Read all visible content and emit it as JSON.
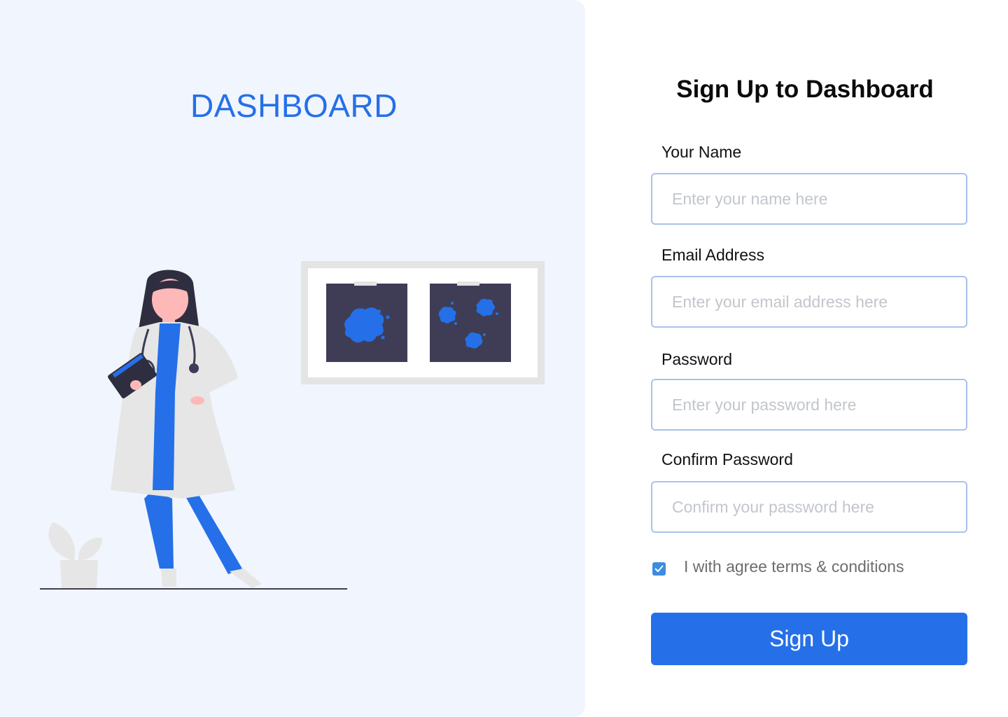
{
  "brand": {
    "title": "DASHBOARD"
  },
  "form": {
    "title": "Sign Up to Dashboard",
    "fields": [
      {
        "label": "Your Name",
        "placeholder": "Enter your name here",
        "value": ""
      },
      {
        "label": "Email Address",
        "placeholder": "Enter your email address here",
        "value": ""
      },
      {
        "label": "Password",
        "placeholder": "Enter your password here",
        "value": ""
      },
      {
        "label": "Confirm Password",
        "placeholder": "Confirm your password here",
        "value": ""
      }
    ],
    "agree": {
      "label": "I with agree terms & conditions",
      "checked": true
    },
    "submit_label": "Sign Up"
  },
  "colors": {
    "accent": "#2570e8",
    "panel_background": "#f1f5fd",
    "input_border": "#a9c2ea",
    "checkbox": "#3b8de0"
  },
  "icons": {
    "checkbox": "check-icon",
    "illustration": "doctor-with-xray-illustration"
  }
}
